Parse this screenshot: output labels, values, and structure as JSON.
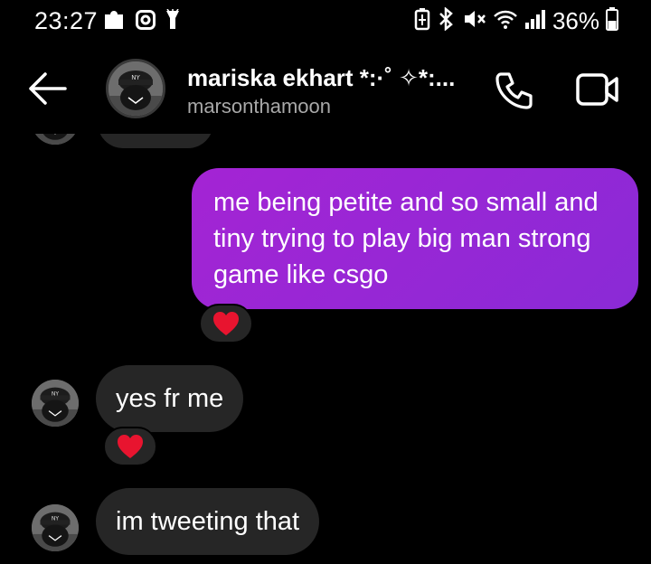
{
  "status_bar": {
    "time": "23:27",
    "battery": "36%",
    "left_icons": [
      "puzzle-icon",
      "instagram-icon",
      "flashlight-icon"
    ],
    "right_icons": [
      "battery-saver-icon",
      "bluetooth-icon",
      "mute-icon",
      "wifi-icon",
      "signal-icon",
      "battery-icon"
    ]
  },
  "header": {
    "back_icon": "arrow-left-icon",
    "name": "mariska ekhart *:·˚ ✧*:...",
    "username": "marsonthamoon",
    "call_icon": "phone-icon",
    "video_icon": "video-icon"
  },
  "messages": [
    {
      "direction": "outgoing",
      "text": "me being petite and so small and tiny trying to play big man strong game like csgo",
      "reaction": "❤️"
    },
    {
      "direction": "incoming",
      "text": "yes fr me",
      "reaction": "❤️"
    },
    {
      "direction": "incoming",
      "text": "im tweeting that"
    }
  ],
  "colors": {
    "outgoing_bubble": "#9b27d5",
    "incoming_bubble": "#262626",
    "secondary_text": "#a8a8a8",
    "heart": "#e8142f"
  }
}
